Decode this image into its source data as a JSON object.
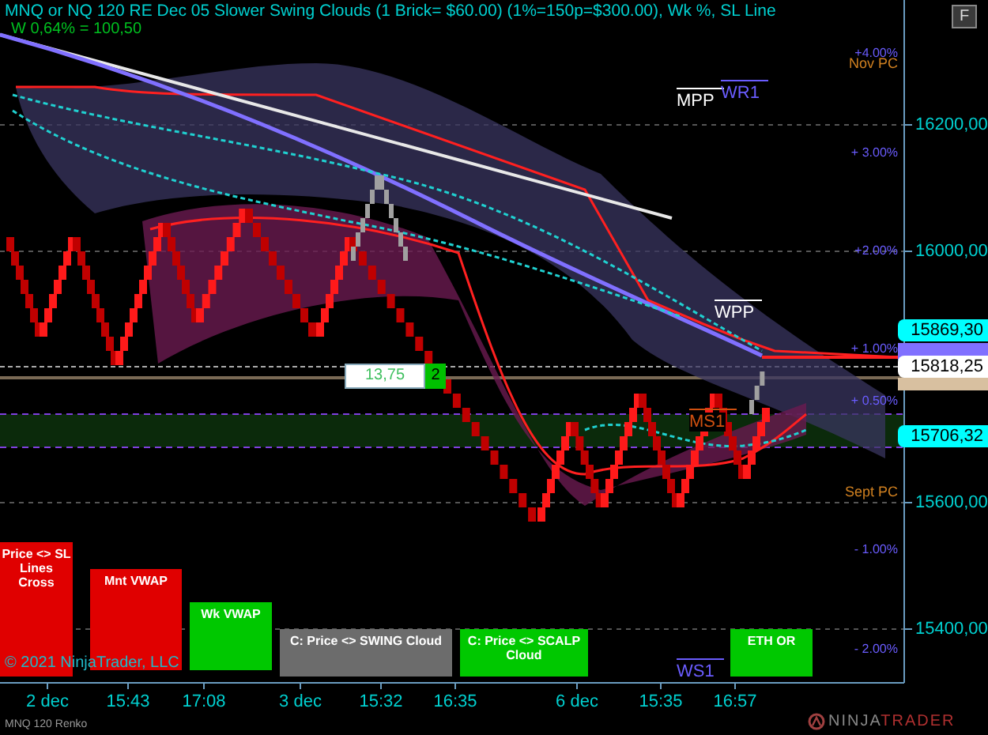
{
  "title": "MNQ or NQ 120 RE Dec 05 Slower Swing Clouds (1 Brick= $60.00) (1%=150p=$300.00), Wk %, SL Line",
  "subtitle": "W 0,64% = 100,50",
  "corner_button": "F",
  "price_ticks": [
    "16200,00",
    "16000,00",
    "15600,00",
    "15400,00"
  ],
  "price_markers": [
    {
      "text": "15869,30",
      "color": "#00ffff"
    },
    {
      "text": "15818,25",
      "color": "#ffffff"
    },
    {
      "text": "15706,32",
      "color": "#00ffff"
    }
  ],
  "percent_labels": [
    "+4.00%",
    "+ 3.00%",
    "+2.00%",
    "+ 1.00%",
    "+ 0.50%",
    "- 1.00%",
    "- 2.00%"
  ],
  "period_labels": [
    "Nov PC",
    "Sept PC"
  ],
  "pivot_labels": [
    {
      "text": "WR1",
      "color": "#6a5cff"
    },
    {
      "text": "MPP",
      "color": "#ffffff"
    },
    {
      "text": "WPP",
      "color": "#ffffff"
    },
    {
      "text": "MS1",
      "color": "#d05010"
    },
    {
      "text": "WS1",
      "color": "#6a5cff"
    }
  ],
  "trade_tag": {
    "value": "13,75",
    "count": "2"
  },
  "signal_boxes": [
    {
      "label": "Price <> SL Lines Cross",
      "color": "#e00000"
    },
    {
      "label": "Mnt VWAP",
      "color": "#e00000"
    },
    {
      "label": "Wk VWAP",
      "color": "#00c800"
    },
    {
      "label": "C: Price <> SWING Cloud",
      "color": "#6c6c6c"
    },
    {
      "label": "C: Price <> SCALP Cloud",
      "color": "#00c800"
    },
    {
      "label": "ETH OR",
      "color": "#00c800"
    }
  ],
  "time_labels": [
    "2 dec",
    "15:43",
    "17:08",
    "3 dec",
    "15:32",
    "16:35",
    "6 dec",
    "15:35",
    "16:57"
  ],
  "copyright": "© 2021 NinjaTrader, LLC",
  "instrument": "MNQ 120 Renko",
  "logo": {
    "first": "NINJA",
    "second": "TRADER"
  }
}
